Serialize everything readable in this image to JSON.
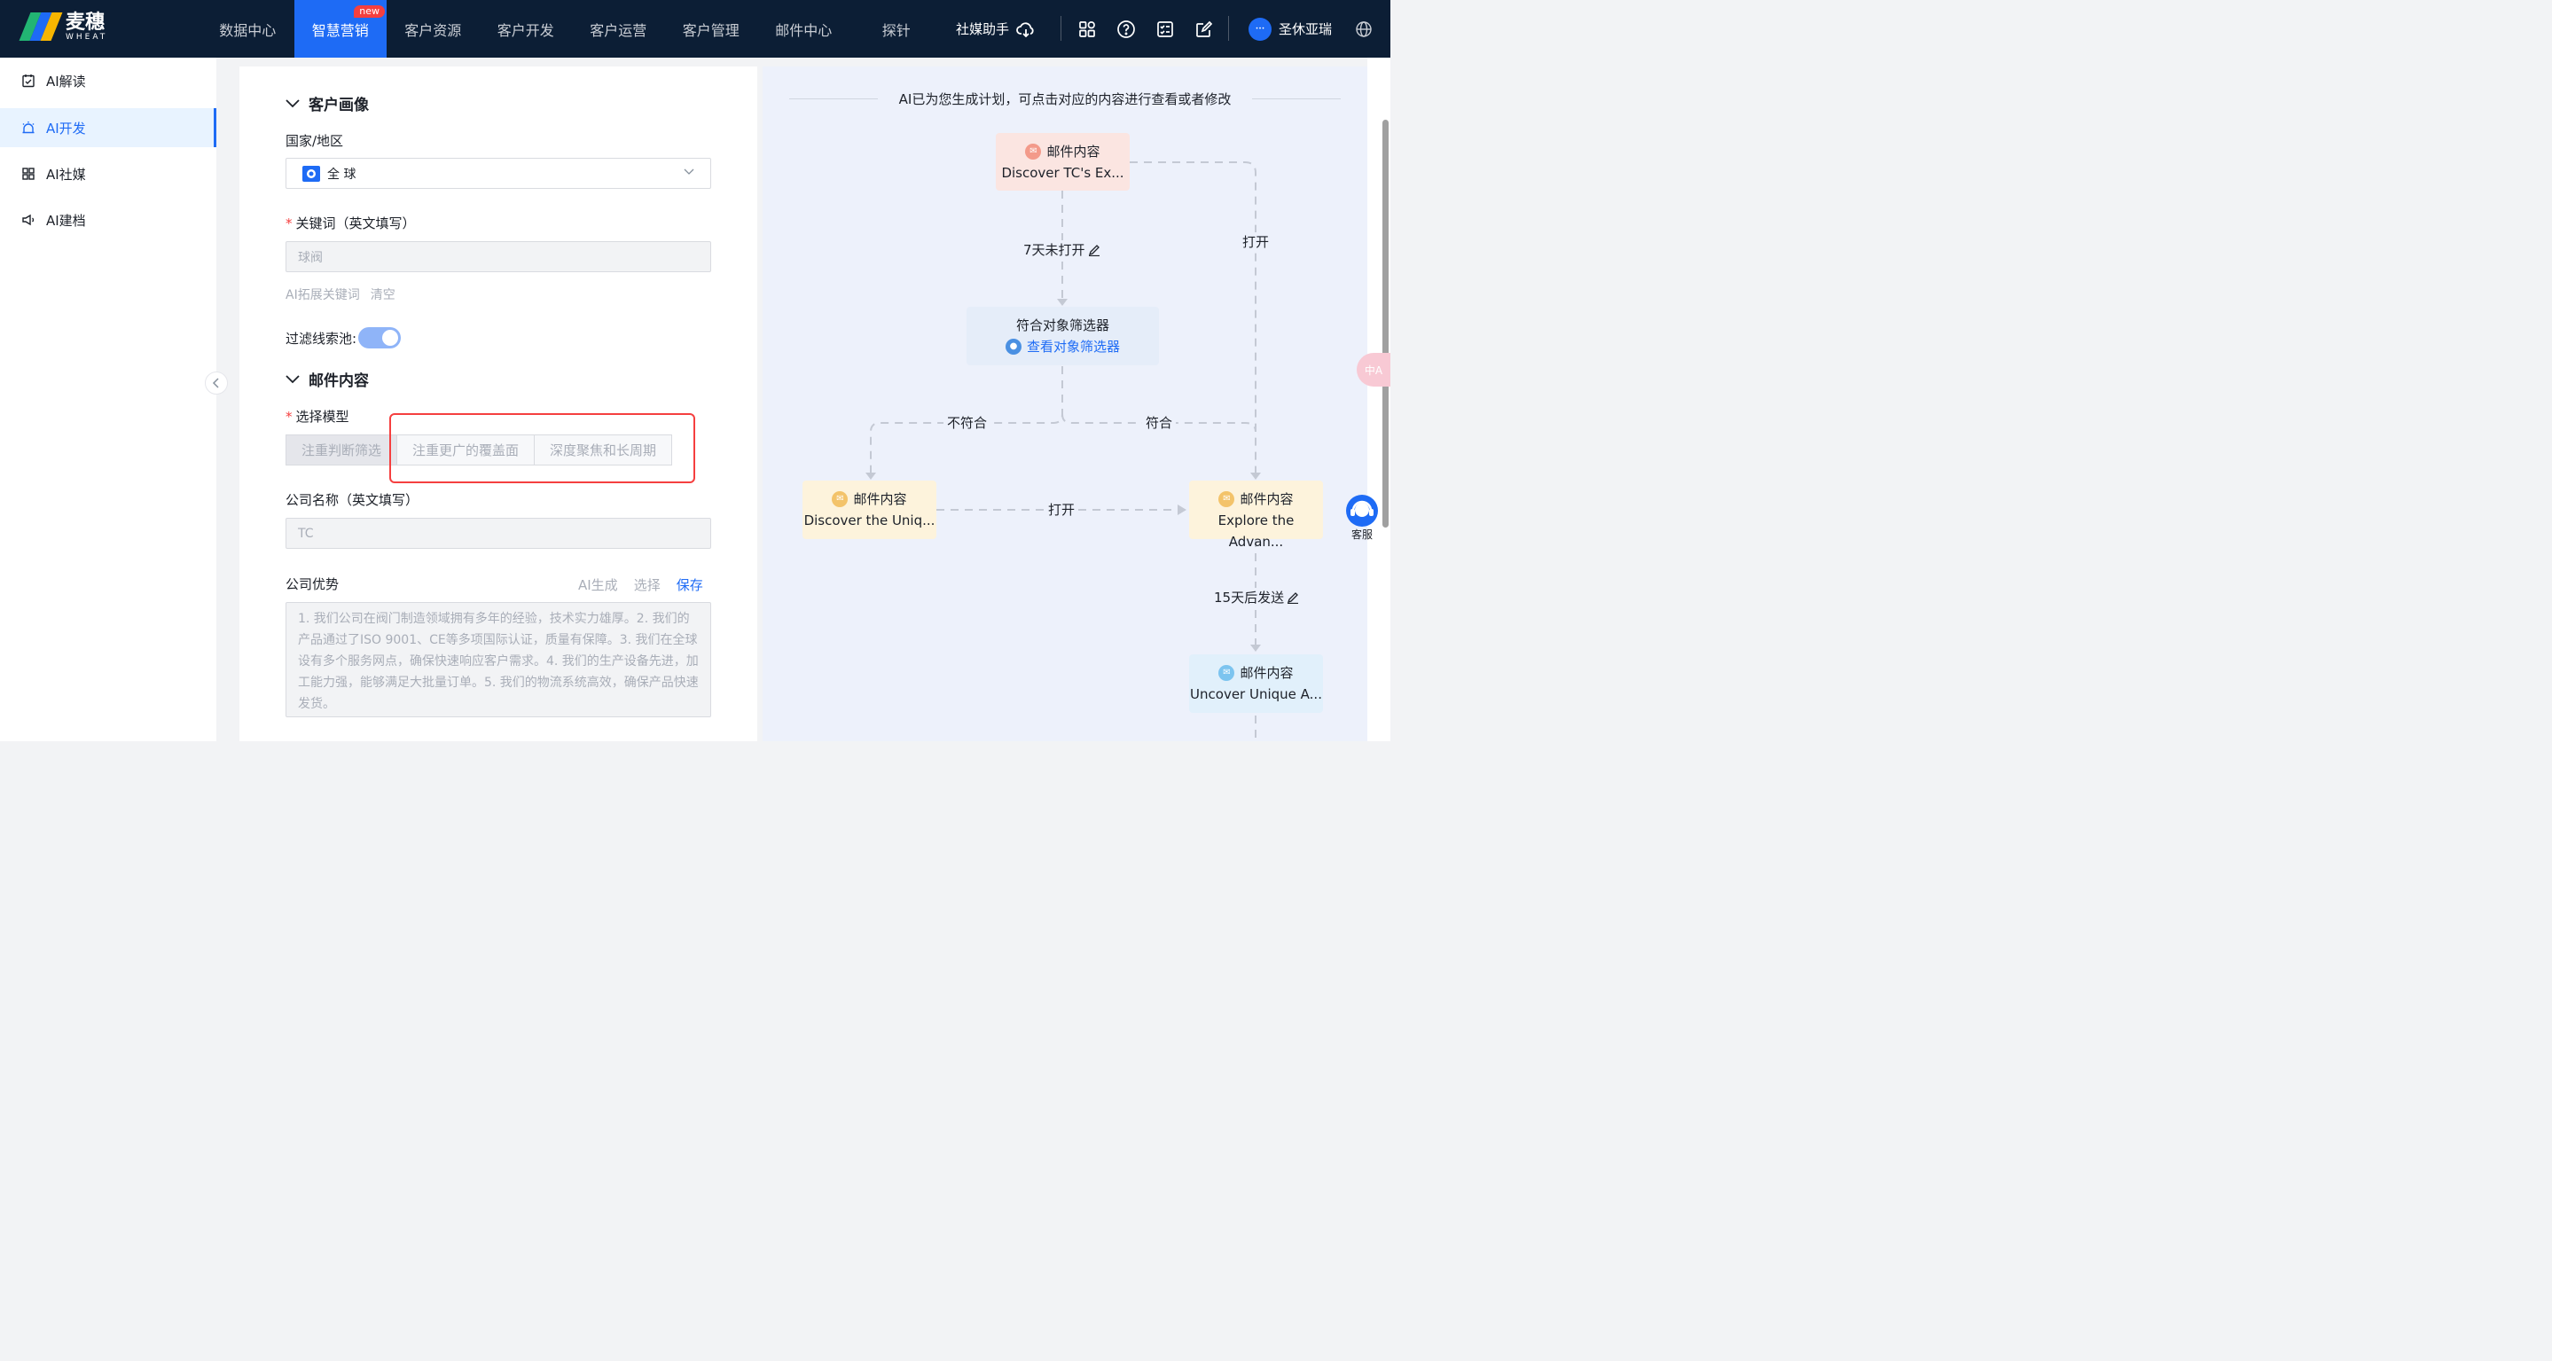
{
  "brand": {
    "cn": "麦穗",
    "en": "WHEAT"
  },
  "nav": {
    "items": [
      "数据中心",
      "智慧营销",
      "客户资源",
      "客户开发",
      "客户运营",
      "客户管理",
      "邮件中心",
      "探针"
    ],
    "badge": "new"
  },
  "topbar": {
    "social": "社媒助手",
    "user": "圣休亚瑞"
  },
  "sidebar": {
    "items": [
      {
        "label": "AI解读",
        "icon": "clipboard-check-icon"
      },
      {
        "label": "AI开发",
        "icon": "alarm-icon"
      },
      {
        "label": "AI社媒",
        "icon": "grid-icon"
      },
      {
        "label": "AI建档",
        "icon": "megaphone-icon"
      }
    ]
  },
  "form": {
    "customer_section": "客户画像",
    "country_label": "国家/地区",
    "country_value": "全 球",
    "keyword_label": "关键词（英文填写）",
    "keyword_placeholder": "球阀",
    "ai_expand": "AI拓展关键词",
    "clear": "清空",
    "filter_label": "过滤线索池:",
    "email_section": "邮件内容",
    "model_label": "选择模型",
    "model_options": [
      "注重判断筛选",
      "注重更广的覆盖面",
      "深度聚焦和长周期"
    ],
    "company_label": "公司名称（英文填写）",
    "company_placeholder": "TC",
    "advantage_label": "公司优势",
    "ai_generate": "AI生成",
    "select": "选择",
    "save": "保存",
    "advantage_text": "1. 我们公司在阀门制造领域拥有多年的经验，技术实力雄厚。2. 我们的产品通过了ISO 9001、CE等多项国际认证，质量有保障。3. 我们在全球设有多个服务网点，确保快速响应客户需求。4. 我们的生产设备先进，加工能力强，能够满足大批量订单。5. 我们的物流系统高效，确保产品快速发货。"
  },
  "flow": {
    "title": "AI已为您生成计划，可点击对应的内容进行查看或者修改",
    "node1": {
      "head": "邮件内容",
      "body": "Discover TC's Ex..."
    },
    "edge_not_open": "7天未打开",
    "edge_open_right": "打开",
    "filter_node": {
      "title": "符合对象筛选器",
      "link": "查看对象筛选器"
    },
    "edge_no_match": "不符合",
    "edge_match": "符合",
    "node2": {
      "head": "邮件内容",
      "body": "Discover the Uniq..."
    },
    "edge_open_mid": "打开",
    "node3": {
      "head": "邮件内容",
      "body": "Explore the Advan..."
    },
    "edge_after": "15天后发送",
    "node4": {
      "head": "邮件内容",
      "body": "Uncover Unique A..."
    }
  },
  "widgets": {
    "lang": "中A",
    "support": "客服"
  },
  "colors": {
    "brand_blue": "#1e6bf5",
    "topbar": "#0c1e35",
    "highlight_red": "#f53f3f",
    "node_pink": "#fbe5e1",
    "node_yellow": "#fdf3dc",
    "node_blue": "#e1f0fb"
  }
}
